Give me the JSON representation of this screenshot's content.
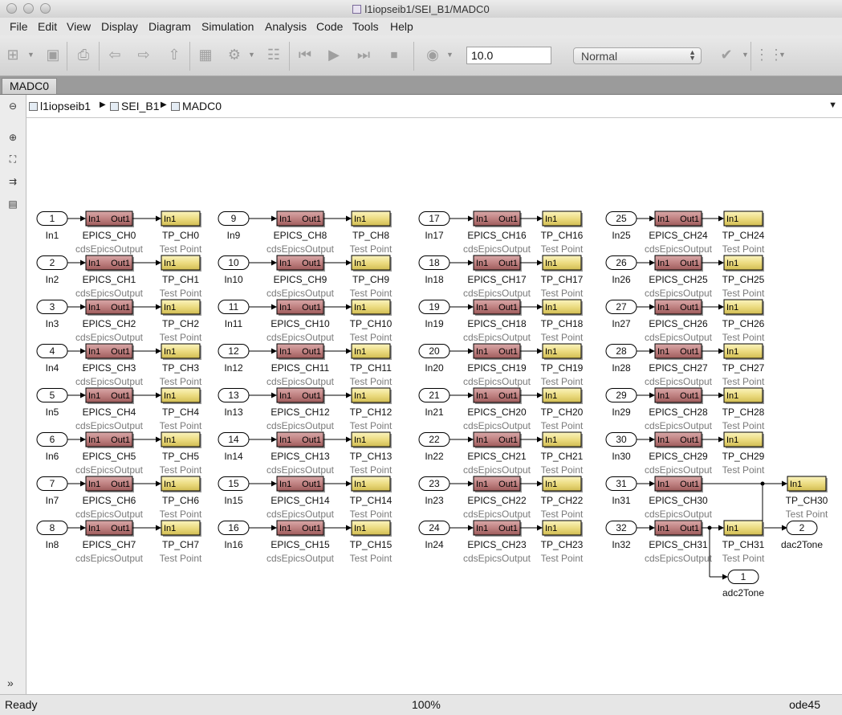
{
  "window": {
    "title": "l1iopseib1/SEI_B1/MADC0"
  },
  "menu": [
    "File",
    "Edit",
    "View",
    "Display",
    "Diagram",
    "Simulation",
    "Analysis",
    "Code",
    "Tools",
    "Help"
  ],
  "toolbar": {
    "stop_time": "10.0",
    "sim_mode": "Normal"
  },
  "tab": {
    "label": "MADC0"
  },
  "breadcrumb": [
    "l1iopseib1",
    "SEI_B1",
    "MADC0"
  ],
  "status": {
    "left": "Ready",
    "zoom": "100%",
    "solver": "ode45"
  },
  "diagram": {
    "in_port_label": "In1",
    "out_port_label": "Out1",
    "epics_type": "cdsEpicsOutput",
    "tp_type": "Test Point",
    "rows": [
      {
        "num": "1",
        "in": "In1",
        "epics": "EPICS_CH0",
        "tp": "TP_CH0"
      },
      {
        "num": "2",
        "in": "In2",
        "epics": "EPICS_CH1",
        "tp": "TP_CH1"
      },
      {
        "num": "3",
        "in": "In3",
        "epics": "EPICS_CH2",
        "tp": "TP_CH2"
      },
      {
        "num": "4",
        "in": "In4",
        "epics": "EPICS_CH3",
        "tp": "TP_CH3"
      },
      {
        "num": "5",
        "in": "In5",
        "epics": "EPICS_CH4",
        "tp": "TP_CH4"
      },
      {
        "num": "6",
        "in": "In6",
        "epics": "EPICS_CH5",
        "tp": "TP_CH5"
      },
      {
        "num": "7",
        "in": "In7",
        "epics": "EPICS_CH6",
        "tp": "TP_CH6"
      },
      {
        "num": "8",
        "in": "In8",
        "epics": "EPICS_CH7",
        "tp": "TP_CH7"
      },
      {
        "num": "9",
        "in": "In9",
        "epics": "EPICS_CH8",
        "tp": "TP_CH8"
      },
      {
        "num": "10",
        "in": "In10",
        "epics": "EPICS_CH9",
        "tp": "TP_CH9"
      },
      {
        "num": "11",
        "in": "In11",
        "epics": "EPICS_CH10",
        "tp": "TP_CH10"
      },
      {
        "num": "12",
        "in": "In12",
        "epics": "EPICS_CH11",
        "tp": "TP_CH11"
      },
      {
        "num": "13",
        "in": "In13",
        "epics": "EPICS_CH12",
        "tp": "TP_CH12"
      },
      {
        "num": "14",
        "in": "In14",
        "epics": "EPICS_CH13",
        "tp": "TP_CH13"
      },
      {
        "num": "15",
        "in": "In15",
        "epics": "EPICS_CH14",
        "tp": "TP_CH14"
      },
      {
        "num": "16",
        "in": "In16",
        "epics": "EPICS_CH15",
        "tp": "TP_CH15"
      },
      {
        "num": "17",
        "in": "In17",
        "epics": "EPICS_CH16",
        "tp": "TP_CH16"
      },
      {
        "num": "18",
        "in": "In18",
        "epics": "EPICS_CH17",
        "tp": "TP_CH17"
      },
      {
        "num": "19",
        "in": "In19",
        "epics": "EPICS_CH18",
        "tp": "TP_CH18"
      },
      {
        "num": "20",
        "in": "In20",
        "epics": "EPICS_CH19",
        "tp": "TP_CH19"
      },
      {
        "num": "21",
        "in": "In21",
        "epics": "EPICS_CH20",
        "tp": "TP_CH20"
      },
      {
        "num": "22",
        "in": "In22",
        "epics": "EPICS_CH21",
        "tp": "TP_CH21"
      },
      {
        "num": "23",
        "in": "In23",
        "epics": "EPICS_CH22",
        "tp": "TP_CH22"
      },
      {
        "num": "24",
        "in": "In24",
        "epics": "EPICS_CH23",
        "tp": "TP_CH23"
      },
      {
        "num": "25",
        "in": "In25",
        "epics": "EPICS_CH24",
        "tp": "TP_CH24"
      },
      {
        "num": "26",
        "in": "In26",
        "epics": "EPICS_CH25",
        "tp": "TP_CH25"
      },
      {
        "num": "27",
        "in": "In27",
        "epics": "EPICS_CH26",
        "tp": "TP_CH26"
      },
      {
        "num": "28",
        "in": "In28",
        "epics": "EPICS_CH27",
        "tp": "TP_CH27"
      },
      {
        "num": "29",
        "in": "In29",
        "epics": "EPICS_CH28",
        "tp": "TP_CH28"
      },
      {
        "num": "30",
        "in": "In30",
        "epics": "EPICS_CH29",
        "tp": "TP_CH29"
      },
      {
        "num": "31",
        "in": "In31",
        "epics": "EPICS_CH30",
        "tp": "TP_CH30"
      },
      {
        "num": "32",
        "in": "In32",
        "epics": "EPICS_CH31",
        "tp": "TP_CH31"
      }
    ],
    "outports": [
      {
        "num": "2",
        "label": "dac2Tone"
      },
      {
        "num": "1",
        "label": "adc2Tone"
      }
    ]
  }
}
